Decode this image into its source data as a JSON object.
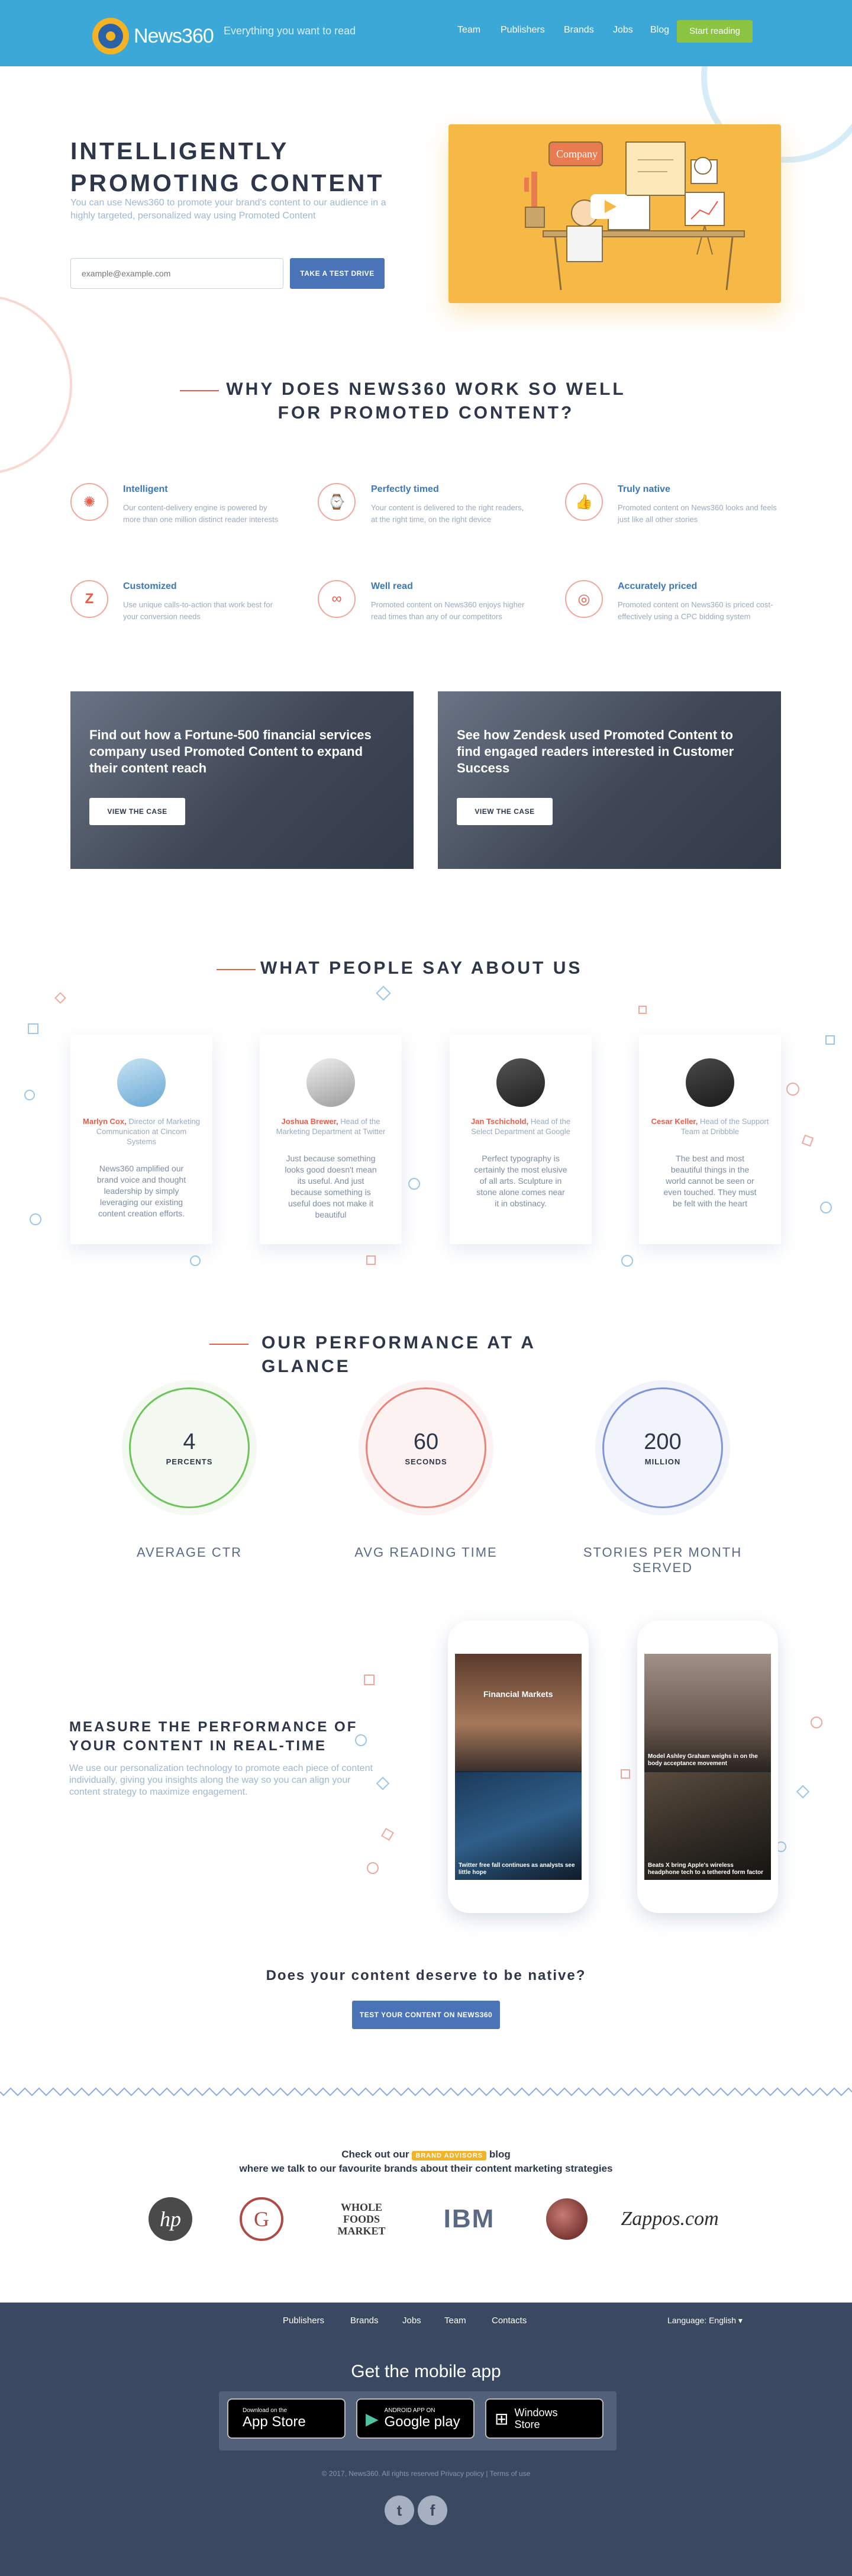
{
  "header": {
    "logo_text": "News360",
    "tagline": "Everything you want to read",
    "nav": [
      "Team",
      "Publishers",
      "Brands",
      "Jobs",
      "Blog"
    ],
    "cta": "Start reading"
  },
  "hero": {
    "title": "INTELLIGENTLY PROMOTING CONTENT",
    "text": "You can use News360 to promote your brand's content to our audience in a highly targeted, personalized way using Promoted Content",
    "email_placeholder": "example@example.com",
    "button": "TAKE A TEST DRIVE",
    "illustration_label": "Company"
  },
  "why": {
    "title_line1": "WHY DOES NEWS360 WORK SO WELL",
    "title_line2": "FOR PROMOTED CONTENT?",
    "features": [
      {
        "title": "Intelligent",
        "text": "Our content-delivery engine is powered by more than one million distinct reader interests",
        "icon": "brain-icon"
      },
      {
        "title": "Perfectly timed",
        "text": "Your content is delivered to the right readers, at the right time, on the right device",
        "icon": "watch-icon"
      },
      {
        "title": "Truly native",
        "text": "Promoted content on News360 looks and feels just like all other stories",
        "icon": "thumbs-up-icon"
      },
      {
        "title": "Customized",
        "text": "Use unique calls-to-action that work best for your conversion needs",
        "icon": "z-icon"
      },
      {
        "title": "Well read",
        "text": "Promoted content on News360 enjoys higher read times than any of our competitors",
        "icon": "glasses-icon"
      },
      {
        "title": "Accurately priced",
        "text": "Promoted content on News360 is priced cost-effectively using a CPC bidding system",
        "icon": "target-icon"
      }
    ]
  },
  "cases": [
    {
      "title": "Find out how a Fortune-500 financial services company used Promoted Content to expand their content reach",
      "button": "VIEW THE CASE"
    },
    {
      "title": "See how Zendesk used Promoted Content to find engaged readers interested in Customer Success",
      "button": "VIEW THE CASE"
    }
  ],
  "testimonials": {
    "title": "WHAT PEOPLE SAY ABOUT US",
    "items": [
      {
        "name": "Marlyn Cox,",
        "role": "Director of Marketing Communication at Cincom Systems",
        "quote": "News360 amplified our brand voice and thought leadership by simply leveraging our existing content creation efforts."
      },
      {
        "name": "Joshua Brewer,",
        "role": "Head of the Marketing Department at Twitter",
        "quote": "Just because something looks good doesn't mean its useful. And just because something is useful does not make it beautiful"
      },
      {
        "name": "Jan Tschichold,",
        "role": "Head of the Select Department at Google",
        "quote": "Perfect typography is certainly the most elusive of all arts. Sculpture in stone alone comes near it in obstinacy."
      },
      {
        "name": "Cesar Keller,",
        "role": "Head of the Support Team at Dribbble",
        "quote": "The best and most beautiful things in the world cannot be seen or even touched. They must be felt with the heart"
      }
    ]
  },
  "performance": {
    "title": "OUR PERFORMANCE AT A GLANCE",
    "stats": [
      {
        "value": "4",
        "unit": "PERCENTS",
        "label": "AVERAGE CTR",
        "color": "#6cc45a"
      },
      {
        "value": "60",
        "unit": "SECONDS",
        "label": "AVG READING TIME",
        "color": "#e8847a"
      },
      {
        "value": "200",
        "unit": "MILLION",
        "label": "STORIES PER MONTH SERVED",
        "color": "#7e95d8"
      }
    ]
  },
  "realtime": {
    "title": "MEASURE THE PERFORMANCE OF YOUR CONTENT IN REAL-TIME",
    "text": "We use our personalization technology to promote each piece of content individually, giving you insights along the way so you can align your content strategy to maximize engagement.",
    "phone1": {
      "card1": "Financial Markets",
      "card2": "Twitter free fall continues as analysts see little hope"
    },
    "phone2": {
      "card1": "Model Ashley Graham weighs in on the body acceptance movement",
      "card2": "Beats X bring Apple's wireless headphone tech to a tethered form factor"
    }
  },
  "question": {
    "title": "Does your content deserve to be native?",
    "button": "TEST YOUR CONTENT ON NEWS360"
  },
  "blog": {
    "line1_pre": "Check out our",
    "line1_brand": "BRAND ADVISORS",
    "line1_post": "blog",
    "line2": "where we talk to our favourite brands about their content marketing strategies",
    "brands": [
      "hp",
      "G",
      "WHOLE FOODS MARKET",
      "IBM",
      "",
      "Zappos.com"
    ]
  },
  "footer": {
    "nav": [
      "Publishers",
      "Brands",
      "Jobs",
      "Team",
      "Contacts"
    ],
    "language": "Language: English",
    "mobile_title": "Get the mobile app",
    "stores": [
      {
        "small": "Download on the",
        "big": "App Store",
        "icon": ""
      },
      {
        "small": "ANDROID APP ON",
        "big": "Google play",
        "icon": "▶"
      },
      {
        "small": "",
        "big": "Windows Store",
        "icon": "⊞"
      }
    ],
    "copyright": "© 2017, News360. All rights reserved Privacy policy | Terms of use"
  }
}
